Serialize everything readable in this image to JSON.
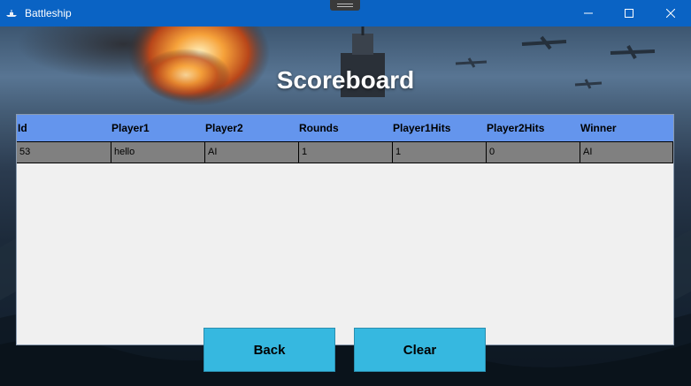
{
  "window": {
    "title": "Battleship"
  },
  "page": {
    "heading": "Scoreboard"
  },
  "table": {
    "columns": [
      "Id",
      "Player1",
      "Player2",
      "Rounds",
      "Player1Hits",
      "Player2Hits",
      "Winner"
    ],
    "rows": [
      [
        "53",
        "hello",
        "AI",
        "1",
        "1",
        "0",
        "AI"
      ]
    ]
  },
  "buttons": {
    "back": "Back",
    "clear": "Clear"
  },
  "colors": {
    "titlebar": "#0a63c4",
    "header": "#6495ed",
    "selected_row": "#808080",
    "button": "#36b8e0",
    "grid_bg": "#f0f0f0"
  },
  "icons": {
    "app": "battleship-icon",
    "minimize": "minimize-icon",
    "maximize": "maximize-icon",
    "close": "close-icon"
  }
}
